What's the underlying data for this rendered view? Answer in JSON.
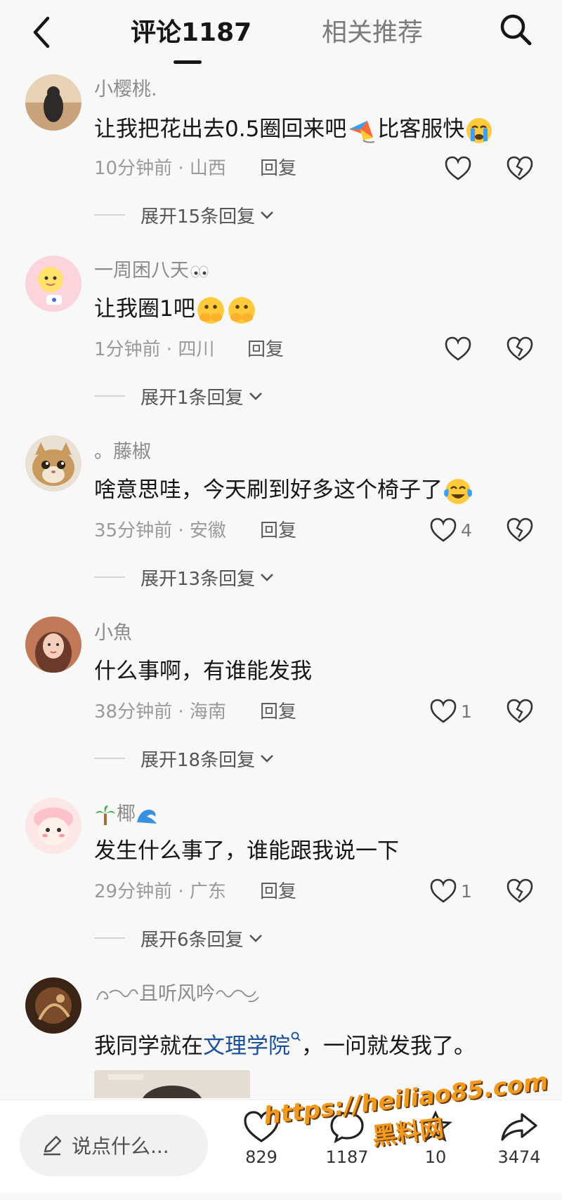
{
  "header": {
    "tab_comments": "评论1187",
    "tab_related": "相关推荐"
  },
  "comments": [
    {
      "username": "小樱桃.",
      "text_before": "让我把花出去0.5圈回来吧",
      "text_after": "比客服快",
      "emoji": [
        "kite-emoji",
        "crying-emoji"
      ],
      "time": "10分钟前 · 山西",
      "reply_label": "回复",
      "likes": "",
      "expand": "展开15条回复"
    },
    {
      "username": "一周困八天",
      "username_emoji": "eyes-emoji",
      "text": "让我圈1吧",
      "emoji": [
        "peeking-face-emoji",
        "peeking-face-emoji"
      ],
      "time": "1分钟前 · 四川",
      "reply_label": "回复",
      "likes": "",
      "expand": "展开1条回复"
    },
    {
      "username": "。藤椒",
      "text": "啥意思哇，今天刷到好多这个椅子了",
      "emoji": [
        "tears-of-joy-emoji"
      ],
      "time": "35分钟前 · 安徽",
      "reply_label": "回复",
      "likes": "4",
      "expand": "展开13条回复"
    },
    {
      "username": "小魚",
      "text": "什么事啊，有谁能发我",
      "time": "38分钟前 · 海南",
      "reply_label": "回复",
      "likes": "1",
      "expand": "展开18条回复"
    },
    {
      "username": "椰",
      "username_emoji": [
        "palm-tree-emoji",
        "wave-emoji"
      ],
      "text": "发生什么事了，谁能跟我说一下",
      "time": "29分钟前 · 广东",
      "reply_label": "回复",
      "likes": "1",
      "expand": "展开6条回复"
    },
    {
      "username": "且听风吟",
      "username_decor": "ornament-glyphs",
      "text_before": "我同学就在",
      "text_link": "文理学院",
      "text_after": "，一问就发我了。"
    }
  ],
  "bottom_bar": {
    "input_placeholder": "说点什么...",
    "likes": "829",
    "comments": "1187",
    "collects": "10",
    "shares": "3474"
  },
  "watermark": {
    "url": "https://heiliao85.com",
    "name": "黑料网"
  },
  "colors": {
    "background": "#f8f8f8",
    "link": "#1b4f9c",
    "watermark": "#f29a1e"
  }
}
